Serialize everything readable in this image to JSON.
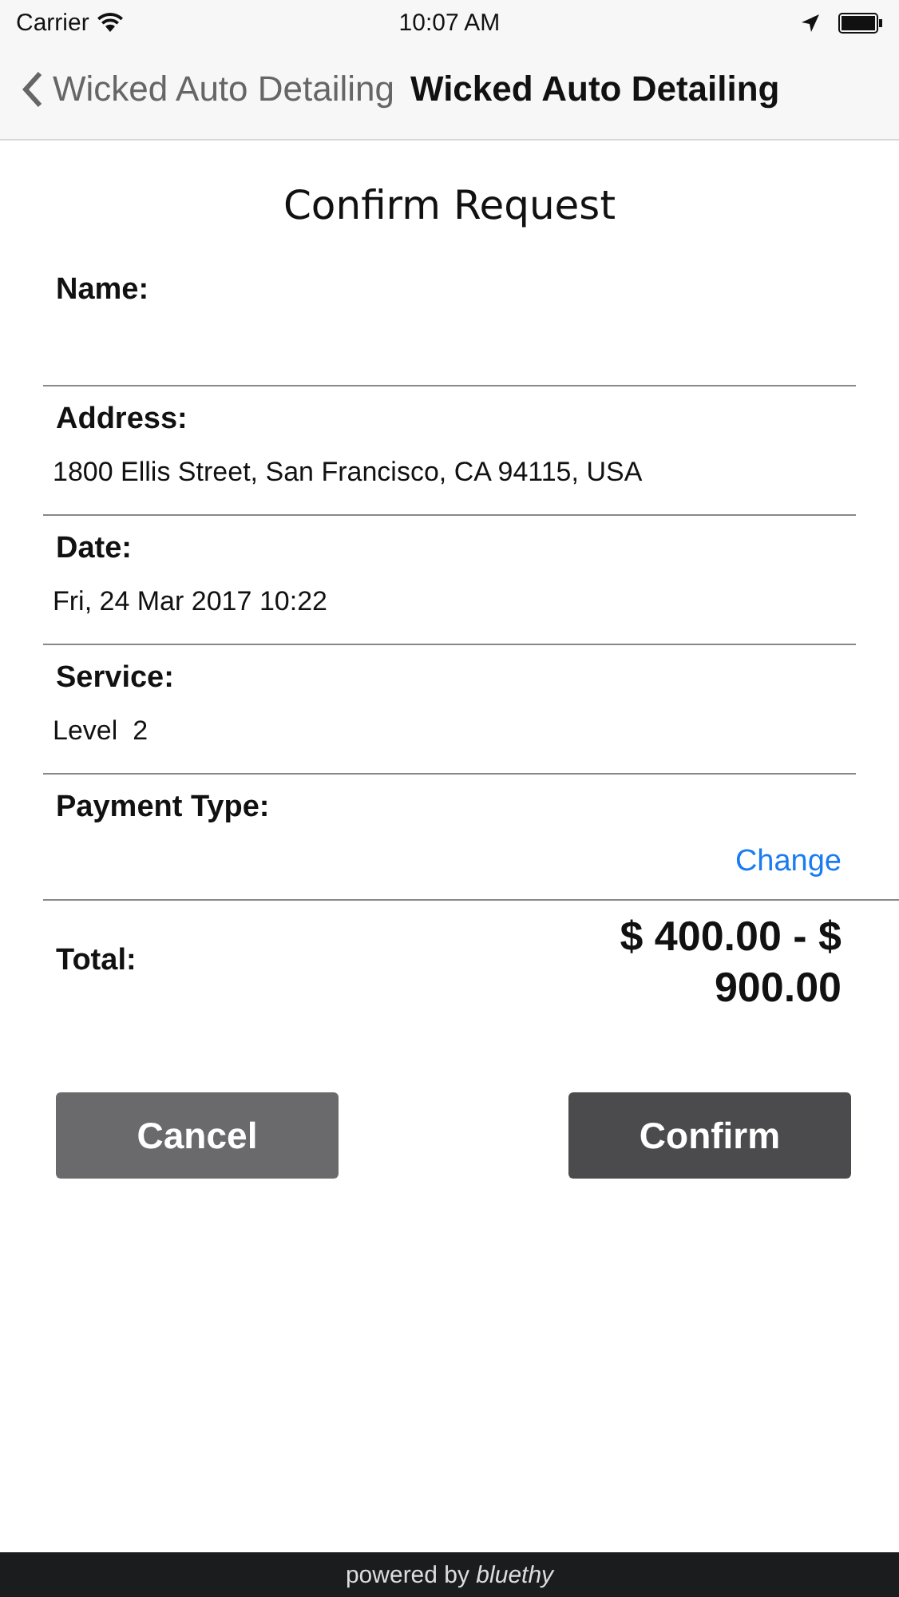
{
  "status_bar": {
    "carrier": "Carrier",
    "time": "10:07 AM"
  },
  "nav": {
    "back_label": "Wicked Auto Detailing",
    "title": "Wicked Auto Detailing"
  },
  "heading": "Confirm Request",
  "fields": [
    {
      "label": "Name:"
    },
    {
      "label": "Address:",
      "value": "1800 Ellis Street, San Francisco, CA 94115, USA"
    },
    {
      "label": "Date:",
      "value": "Fri, 24 Mar 2017 10:22"
    },
    {
      "label": "Service:",
      "value": "Level  2"
    }
  ],
  "payment": {
    "label": "Payment Type:",
    "action": "Change"
  },
  "total": {
    "label": "Total:",
    "amount_line_1": "$ 400.00 - $",
    "amount_line_2": "900.00"
  },
  "buttons": [
    {
      "label": "Cancel",
      "kind": "secondary"
    },
    {
      "label": "Confirm",
      "kind": "primary"
    }
  ],
  "footer": "powered by *bluethy*"
}
